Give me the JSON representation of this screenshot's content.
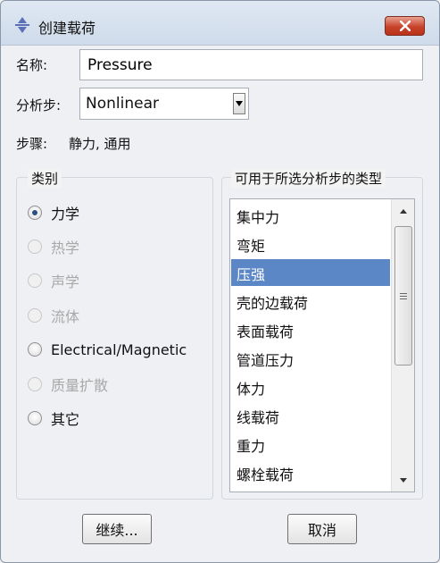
{
  "window": {
    "title": "创建载荷",
    "close_icon": "close-icon"
  },
  "form": {
    "name_label": "名称:",
    "name_value": "Pressure",
    "step_label": "分析步:",
    "step_value": "Nonlinear",
    "procedure_label": "步骤:",
    "procedure_value": "静力, 通用"
  },
  "category": {
    "title": "类别",
    "options": [
      {
        "label": "力学",
        "checked": true,
        "disabled": false
      },
      {
        "label": "热学",
        "checked": false,
        "disabled": true
      },
      {
        "label": "声学",
        "checked": false,
        "disabled": true
      },
      {
        "label": "流体",
        "checked": false,
        "disabled": true
      },
      {
        "label": "Electrical/Magnetic",
        "checked": false,
        "disabled": false
      },
      {
        "label": "质量扩散",
        "checked": false,
        "disabled": true
      },
      {
        "label": "其它",
        "checked": false,
        "disabled": false
      }
    ]
  },
  "types": {
    "title": "可用于所选分析步的类型",
    "items": [
      "集中力",
      "弯矩",
      "压强",
      "壳的边载荷",
      "表面载荷",
      "管道压力",
      "体力",
      "线载荷",
      "重力",
      "螺栓载荷"
    ],
    "selected_index": 2
  },
  "buttons": {
    "continue_label": "继续...",
    "cancel_label": "取消"
  },
  "colors": {
    "selection": "#5b87c7",
    "close_button": "#c8432b"
  }
}
